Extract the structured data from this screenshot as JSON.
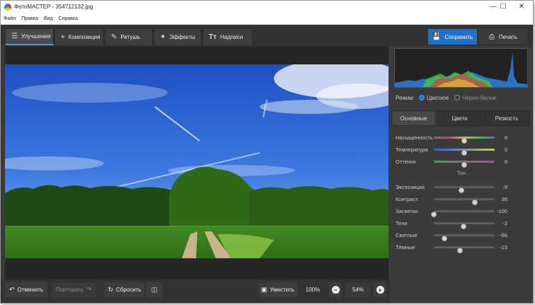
{
  "window": {
    "title": "ФотоМАСТЕР - 354712132.jpg"
  },
  "menu": [
    "Файл",
    "Правка",
    "Вид",
    "Справка"
  ],
  "tabs": [
    {
      "label": "Улучшения",
      "icon": "sliders-icon",
      "active": true
    },
    {
      "label": "Композиция",
      "icon": "crop-icon",
      "active": false
    },
    {
      "label": "Ретушь",
      "icon": "brush-icon",
      "active": false
    },
    {
      "label": "Эффекты",
      "icon": "magic-wand-icon",
      "active": false
    },
    {
      "label": "Надписи",
      "icon": "text-icon",
      "active": false
    }
  ],
  "actions": {
    "save": "Сохранить",
    "print": "Печать"
  },
  "bottom": {
    "undo": "Отменить",
    "redo": "Повторить",
    "reset": "Сбросить",
    "fit": "Уместить",
    "zoom100": "100%",
    "zoom": "54%"
  },
  "mode": {
    "label": "Режим:",
    "color": "Цветное",
    "bw": "Черно-белое",
    "selected": "color"
  },
  "subtabs": [
    "Основные",
    "Цвета",
    "Резкость"
  ],
  "sliders_color": [
    {
      "label": "Насыщенность",
      "value": "0",
      "pos": 0.5,
      "track": "sat"
    },
    {
      "label": "Температура",
      "value": "0",
      "pos": 0.5,
      "track": "temp"
    },
    {
      "label": "Оттенок",
      "value": "0",
      "pos": 0.5,
      "track": "tint"
    }
  ],
  "tone_header": "Тон",
  "sliders_tone": [
    {
      "label": "Экспозиция",
      "value": "-9",
      "pos": 0.455
    },
    {
      "label": "Контраст",
      "value": "36",
      "pos": 0.68
    },
    {
      "label": "Засветки",
      "value": "-100",
      "pos": 0.0
    },
    {
      "label": "Тени",
      "value": "-2",
      "pos": 0.49
    },
    {
      "label": "Светлые",
      "value": "-66",
      "pos": 0.17
    },
    {
      "label": "Тёмные",
      "value": "-15",
      "pos": 0.425
    }
  ],
  "colors": {
    "accent": "#1f72c7",
    "panel": "#3b3b3b",
    "toolbar": "#333333"
  }
}
